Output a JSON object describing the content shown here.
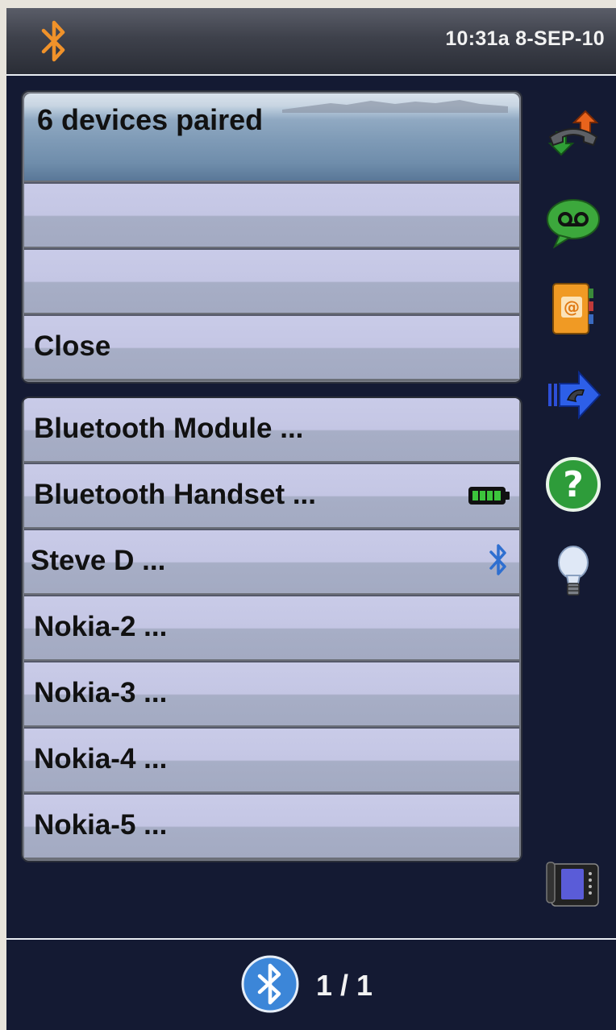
{
  "status_bar": {
    "icon": "bluetooth-icon",
    "clock": "10:31a 8-SEP-10"
  },
  "menu_panel": {
    "title": "6 devices paired",
    "rows": [
      "",
      "",
      "Close"
    ]
  },
  "devices_panel": {
    "devices": [
      {
        "label": "Bluetooth Module ...",
        "indicator": ""
      },
      {
        "label": "Bluetooth Handset ...",
        "indicator": "battery-full-icon"
      },
      {
        "label": "Steve D ...",
        "indicator": "bluetooth-icon"
      },
      {
        "label": "Nokia-2 ...",
        "indicator": ""
      },
      {
        "label": "Nokia-3 ...",
        "indicator": ""
      },
      {
        "label": "Nokia-4 ...",
        "indicator": ""
      },
      {
        "label": "Nokia-5 ...",
        "indicator": ""
      }
    ]
  },
  "sidebar": {
    "icons": [
      "call-transfer-icon",
      "voicemail-icon",
      "contacts-icon",
      "forward-call-icon",
      "help-icon",
      "lightbulb-icon",
      "desk-phone-icon"
    ]
  },
  "bottom_bar": {
    "icon": "bluetooth-icon",
    "pager": "1 / 1"
  },
  "colors": {
    "screen_bg": "#141a33",
    "row_light": "#c9cbe8",
    "row_dark": "#a7aec6",
    "bluetooth_orange": "#f0922a",
    "bluetooth_blue": "#2f6fd0"
  }
}
